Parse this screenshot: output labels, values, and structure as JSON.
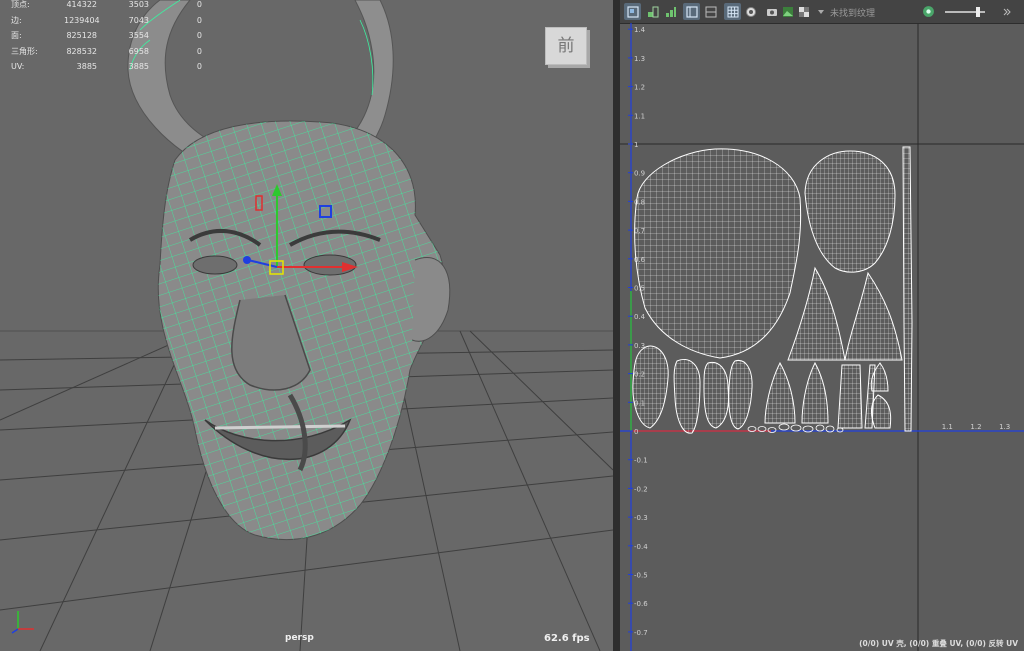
{
  "viewport": {
    "camera": "persp",
    "fps": "62.6 fps",
    "view_cube_label": "前",
    "stats": [
      {
        "label": "顶点:",
        "total": "414322",
        "selected": "3503",
        "extra": "0"
      },
      {
        "label": "边:",
        "total": "1239404",
        "selected": "7043",
        "extra": "0"
      },
      {
        "label": "面:",
        "total": "825128",
        "selected": "3554",
        "extra": "0"
      },
      {
        "label": "三角形:",
        "total": "828532",
        "selected": "6958",
        "extra": "0"
      },
      {
        "label": "UV:",
        "total": "3885",
        "selected": "3885",
        "extra": "0"
      }
    ]
  },
  "uv_editor": {
    "toolbar": {
      "texture_placeholder": "未找到纹理",
      "icons": [
        "uv-shell-icon",
        "uv-border-icon",
        "uv-distortion-icon",
        "uv-frame-icon",
        "uv-grid-icon",
        "checker-icon",
        "shaded-icon",
        "texture-icon",
        "image-icon",
        "checker-map-icon",
        "dropdown-arrow-icon",
        "color-wheel-icon",
        "slider-icon",
        "more-icon"
      ]
    },
    "axis_ticks": {
      "y": [
        "1.4",
        "1.3",
        "1.2",
        "1.1",
        "1",
        "0.9",
        "0.8",
        "0.7",
        "0.6",
        "0.5",
        "0.4",
        "0.3",
        "0.2",
        "0.1",
        "0",
        "-0.1",
        "-0.2",
        "-0.3",
        "-0.4",
        "-0.5",
        "-0.6",
        "-0.7"
      ],
      "x": [
        "1.1",
        "1.2",
        "1.3"
      ]
    },
    "status": "(0/0) UV 壳, (0/0) 重叠 UV, (0/0) 反转 UV"
  },
  "colors": {
    "viewport_bg": "#686868",
    "uv_bg": "#5c5c5c",
    "wire_green": "#3cf0a0",
    "axis_blue": "#1f3fe0",
    "axis_green": "#2ec82e",
    "axis_red": "#e03030"
  }
}
